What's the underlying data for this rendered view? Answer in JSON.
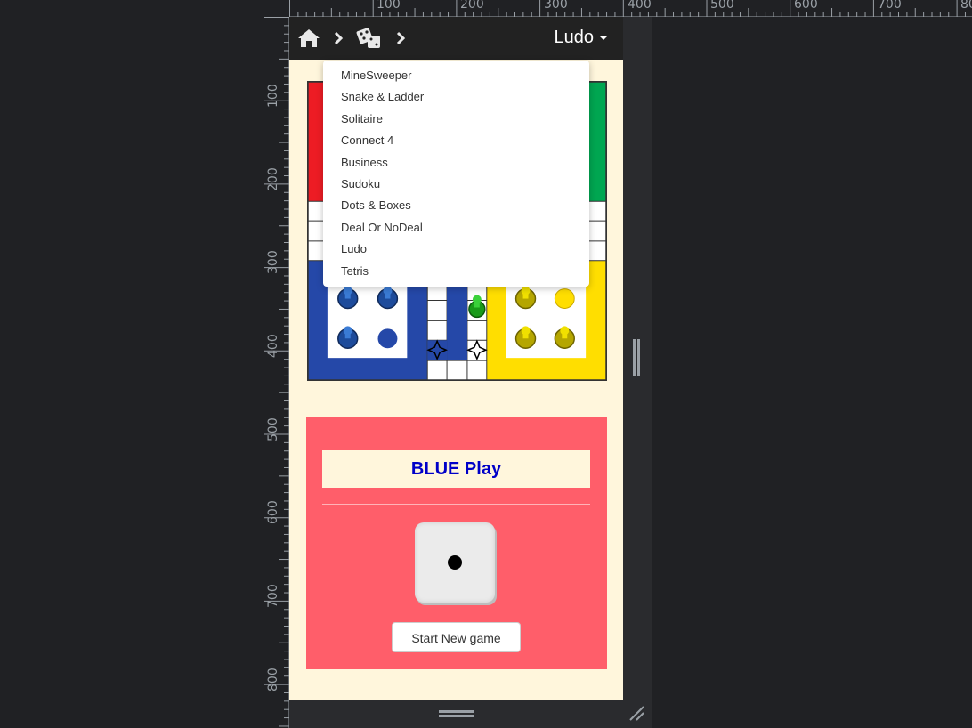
{
  "ruler": {
    "top_labels": [
      "100",
      "200",
      "300",
      "400",
      "500",
      "600",
      "700",
      "800"
    ],
    "left_labels": [
      "100",
      "200",
      "300",
      "400",
      "500",
      "600",
      "700",
      "800"
    ]
  },
  "navbar": {
    "current_game": "Ludo",
    "home_icon": "home-icon",
    "dice_icon": "dice-icon"
  },
  "dropdown": {
    "items": [
      "MineSweeper",
      "Snake & Ladder",
      "Solitaire",
      "Connect 4",
      "Business",
      "Sudoku",
      "Dots & Boxes",
      "Deal Or NoDeal",
      "Ludo",
      "Tetris"
    ]
  },
  "board": {
    "colors": {
      "red": "#ed1c24",
      "green": "#00a651",
      "blue": "#2548a8",
      "yellow": "#ffde00"
    }
  },
  "panel": {
    "turn_text": "BLUE Play",
    "dice_value": 1,
    "new_game_label": "Start New game"
  },
  "colors": {
    "page_bg": "#fff6dc",
    "panel_bg": "#ff5e6a",
    "turn_text": "#0000c8",
    "navbar_bg": "#222222"
  }
}
